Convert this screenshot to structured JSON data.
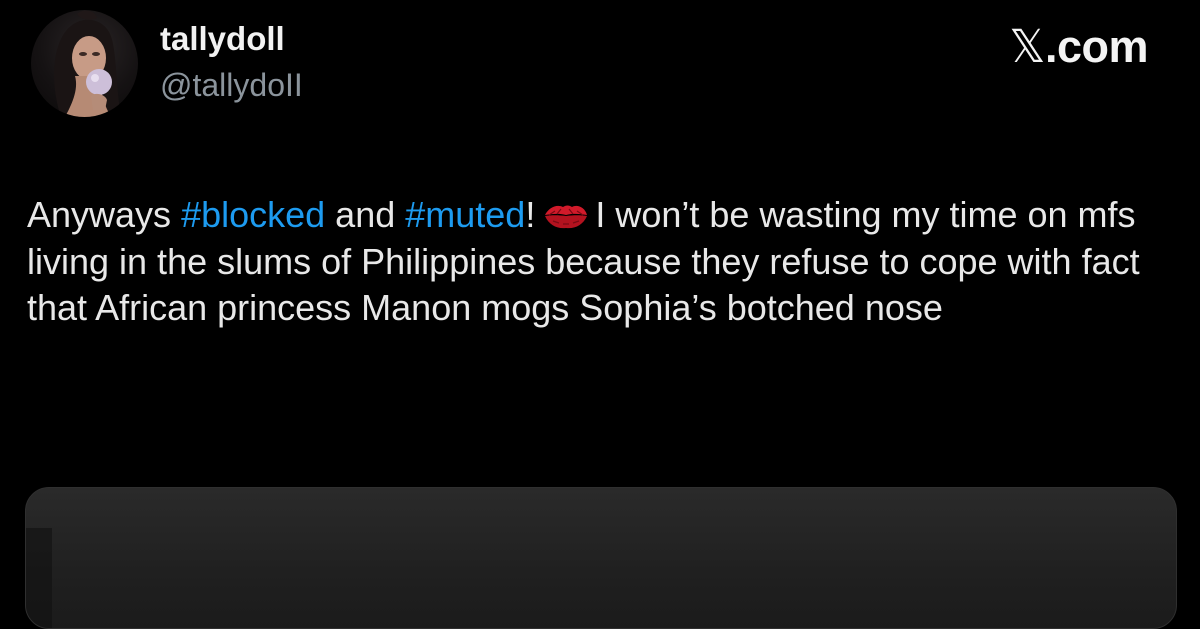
{
  "author": {
    "display_name": "tallydoll",
    "handle": "@tallydoII",
    "avatar": "profile-photo"
  },
  "brand": {
    "label": "X.com",
    "x_glyph": "𝕏",
    "suffix": ".com"
  },
  "tweet": {
    "segments": [
      {
        "type": "text",
        "text": "Anyways "
      },
      {
        "type": "hashtag",
        "text": "#blocked"
      },
      {
        "type": "text",
        "text": " and "
      },
      {
        "type": "hashtag",
        "text": "#muted"
      },
      {
        "type": "text",
        "text": "!"
      },
      {
        "type": "emoji",
        "name": "kiss-mark-icon"
      },
      {
        "type": "text",
        "text": "I won’t be wasting my time on mfs living in the slums of Philippines because they refuse to cope with fact that African princess Manon mogs Sophia’s botched nose"
      }
    ]
  },
  "media": {
    "type": "image-preview"
  },
  "colors": {
    "background": "#000000",
    "hashtag": "#1d9bf0",
    "handle": "#8b949c",
    "text": "#e8e8e8"
  }
}
